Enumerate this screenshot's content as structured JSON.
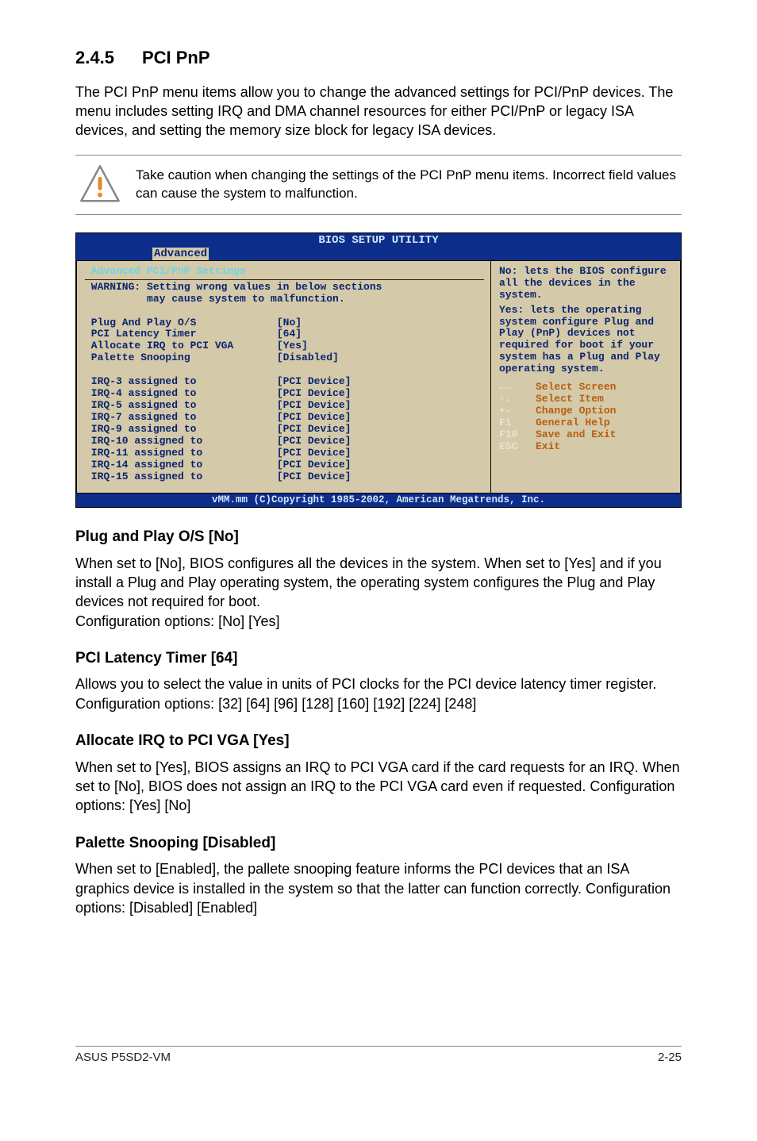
{
  "heading": {
    "num": "2.4.5",
    "title": "PCI PnP"
  },
  "intro": "The PCI PnP menu items allow you to change the advanced settings for PCI/PnP devices. The menu includes setting IRQ and DMA channel resources for either PCI/PnP or legacy ISA devices, and setting the memory size block for legacy ISA devices.",
  "caution": "Take caution when changing the settings of the PCI PnP menu items. Incorrect field values can cause the system to malfunction.",
  "bios": {
    "title": "BIOS SETUP UTILITY",
    "tab": "Advanced",
    "heading": "Advanced PCI/PnP Settings",
    "warning_l1": "WARNING: Setting wrong values in below sections",
    "warning_l2": "         may cause system to malfunction.",
    "rows": [
      {
        "label": "Plug And Play O/S",
        "value": "[No]"
      },
      {
        "label": "PCI Latency Timer",
        "value": "[64]"
      },
      {
        "label": "Allocate IRQ to PCI VGA",
        "value": "[Yes]"
      },
      {
        "label": "Palette Snooping",
        "value": "[Disabled]"
      }
    ],
    "irq_rows": [
      {
        "label": "IRQ-3 assigned to",
        "value": "[PCI Device]"
      },
      {
        "label": "IRQ-4 assigned to",
        "value": "[PCI Device]"
      },
      {
        "label": "IRQ-5 assigned to",
        "value": "[PCI Device]"
      },
      {
        "label": "IRQ-7 assigned to",
        "value": "[PCI Device]"
      },
      {
        "label": "IRQ-9 assigned to",
        "value": "[PCI Device]"
      },
      {
        "label": "IRQ-10 assigned to",
        "value": "[PCI Device]"
      },
      {
        "label": "IRQ-11 assigned to",
        "value": "[PCI Device]"
      },
      {
        "label": "IRQ-14 assigned to",
        "value": "[PCI Device]"
      },
      {
        "label": "IRQ-15 assigned to",
        "value": "[PCI Device]"
      }
    ],
    "help": {
      "top1": "No: lets the BIOS configure all the devices in the system.",
      "top2": "Yes: lets the operating system configure Plug and Play (PnP) devices not required for boot if your system has a Plug and Play operating system.",
      "keys": [
        {
          "k": "←→",
          "d": "Select Screen"
        },
        {
          "k": "↑↓",
          "d": "Select Item"
        },
        {
          "k": "+-",
          "d": "Change Option"
        },
        {
          "k": "F1",
          "d": "General Help"
        },
        {
          "k": "F10",
          "d": "Save and Exit"
        },
        {
          "k": "ESC",
          "d": "Exit"
        }
      ]
    },
    "footer": "vMM.mm (C)Copyright 1985-2002, American Megatrends, Inc."
  },
  "sections": [
    {
      "title": "Plug and Play O/S [No]",
      "body": "When set to [No], BIOS configures all the devices in the system. When set to [Yes] and if you install a Plug and Play operating system, the operating system configures the Plug and Play devices not required for boot.\nConfiguration options: [No] [Yes]"
    },
    {
      "title": "PCI Latency Timer [64]",
      "body": "Allows you to select the value in units of PCI clocks for the PCI device latency timer register. Configuration options: [32] [64] [96] [128] [160] [192] [224] [248]"
    },
    {
      "title": "Allocate IRQ to PCI VGA [Yes]",
      "body": "When set to [Yes], BIOS assigns an IRQ to PCI VGA card if the card requests for an IRQ. When set to [No], BIOS does not assign an IRQ to the PCI VGA card even if requested. Configuration options: [Yes] [No]"
    },
    {
      "title": "Palette Snooping [Disabled]",
      "body": "When set to [Enabled], the pallete snooping feature informs the PCI devices that an ISA graphics device is installed in the system so that the latter can function correctly. Configuration options: [Disabled] [Enabled]"
    }
  ],
  "footer": {
    "left": "ASUS P5SD2-VM",
    "right": "2-25"
  }
}
